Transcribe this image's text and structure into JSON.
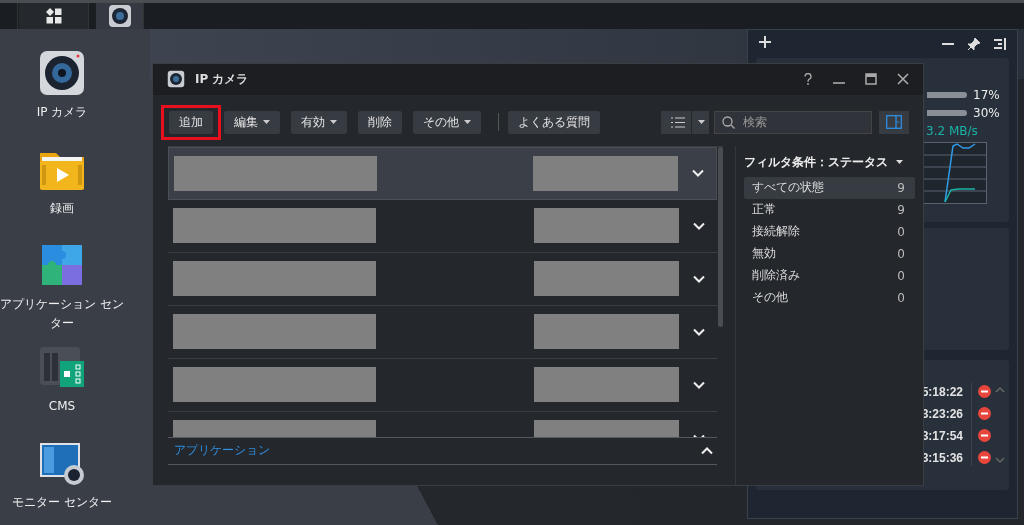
{
  "taskbar": {
    "buttons": [
      {
        "kind": "apps",
        "selected": false
      },
      {
        "kind": "camera",
        "selected": true
      }
    ]
  },
  "desktop_icons": [
    {
      "label": "IP カメラ",
      "kind": "camera"
    },
    {
      "label": "録画",
      "kind": "recording"
    },
    {
      "label": "アプリケーション センター",
      "kind": "package"
    },
    {
      "label": "CMS",
      "kind": "cms"
    },
    {
      "label": "モニター センター",
      "kind": "monitor"
    }
  ],
  "window": {
    "title": "IP カメラ",
    "toolbar": [
      {
        "label": "追加",
        "dropdown": false,
        "highlighted": true
      },
      {
        "label": "編集",
        "dropdown": true,
        "highlighted": false
      },
      {
        "label": "有効",
        "dropdown": true,
        "highlighted": false
      },
      {
        "label": "削除",
        "dropdown": false,
        "highlighted": false
      },
      {
        "label": "その他",
        "dropdown": true,
        "highlighted": false
      }
    ],
    "faq_button": "よくある質問",
    "search": {
      "placeholder": "検索"
    },
    "rows": [
      {
        "selected": true
      },
      {
        "selected": false
      },
      {
        "selected": false
      },
      {
        "selected": false
      },
      {
        "selected": false
      },
      {
        "selected": false
      }
    ],
    "section": "アプリケーション",
    "filter": {
      "title": "フィルタ条件：ステータス",
      "items": [
        {
          "label": "すべての状態",
          "count": "9",
          "selected": true
        },
        {
          "label": "正常",
          "count": "9",
          "selected": false
        },
        {
          "label": "接続解除",
          "count": "0",
          "selected": false
        },
        {
          "label": "無効",
          "count": "0",
          "selected": false
        },
        {
          "label": "削除済み",
          "count": "0",
          "selected": false
        },
        {
          "label": "その他",
          "count": "0",
          "selected": false
        }
      ]
    }
  },
  "widget": {
    "meters": [
      {
        "reading": "17%"
      },
      {
        "reading": "30%"
      }
    ],
    "rate": "3.2 MB/s",
    "events": [
      {
        "time": "5:18:22"
      },
      {
        "time": "3:23:26"
      },
      {
        "time": "3:17:54"
      },
      {
        "time": "3:15:36"
      }
    ]
  }
}
